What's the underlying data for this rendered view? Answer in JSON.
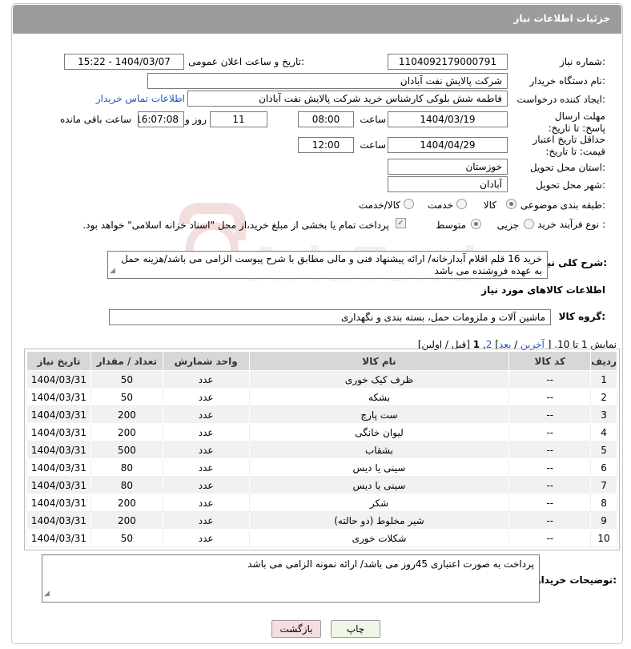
{
  "header": {
    "title": "جزئیات اطلاعات نیاز"
  },
  "form": {
    "need_number_label": "شماره نیاز:",
    "need_number": "1104092179000791",
    "announce_label": "تاریخ و ساعت اعلان عمومی:",
    "announce_value": "1404/03/07 - 15:22",
    "buyer_org_label": "نام دستگاه خریدار:",
    "buyer_org": "شرکت پالایش نفت آبادان",
    "requester_label": "ایجاد کننده درخواست:",
    "requester": "فاطمه شش بلوکی کارشناس خرید شرکت پالایش نفت آبادان",
    "contact_link": "اطلاعات تماس خریدار",
    "deadline_label": "مهلت ارسال پاسخ: تا تاریخ:",
    "deadline_date": "1404/03/19",
    "time_label": "ساعت",
    "deadline_time": "08:00",
    "days_value": "11",
    "days_label": "روز و",
    "remaining_time": "16:07:08",
    "remaining_label": "ساعت باقی مانده",
    "price_validity_label": "حداقل تاریخ اعتبار قیمت: تا تاریخ:",
    "price_validity_date": "1404/04/29",
    "price_validity_time": "12:00",
    "province_label": "استان محل تحویل:",
    "province": "خوزستان",
    "city_label": "شهر محل تحویل:",
    "city": "آبادان",
    "category_label": "طبقه بندی موضوعی:",
    "category_options": [
      "کالا",
      "خدمت",
      "کالا/خدمت"
    ],
    "category_selected": "کالا",
    "process_label": "نوع فرآیند خرید :",
    "process_options": [
      "جزیی",
      "متوسط"
    ],
    "process_selected": "متوسط",
    "payment_note": "پرداخت تمام یا بخشی از مبلغ خرید،از محل \"اسناد خزانه اسلامی\" خواهد بود."
  },
  "description": {
    "label": "شرح کلی نیاز:",
    "text": "خرید 16 قلم اقلام آبدارخانه/ ارائه پیشنهاد فنی و مالی مطابق با شرح پیوست الزامی می باشد/هزینه حمل به عهده فروشنده می باشد"
  },
  "goods": {
    "section_title": "اطلاعات کالاهای مورد نیاز",
    "group_label": "گروه کالا:",
    "group_value": "ماشین آلات و ملزومات حمل، بسته بندی و نگهداری",
    "pagination": {
      "showing": "نمایش 1 تا 10.",
      "open": "[",
      "last": "آخرین",
      "sep1": "/",
      "next": "بعد",
      "close1": "]",
      "page2": "2",
      "comma": ",",
      "page1": "1",
      "prev_first": "[قبل / اولین]"
    },
    "columns": [
      "ردیف",
      "کد کالا",
      "نام کالا",
      "واحد شمارش",
      "تعداد / مقدار",
      "تاریخ نیاز"
    ],
    "rows": [
      [
        "1",
        "--",
        "ظرف کیک خوری",
        "عدد",
        "50",
        "1404/03/31"
      ],
      [
        "2",
        "--",
        "بشکه",
        "عدد",
        "50",
        "1404/03/31"
      ],
      [
        "3",
        "--",
        "ست پارچ",
        "عدد",
        "200",
        "1404/03/31"
      ],
      [
        "4",
        "--",
        "لیوان خانگی",
        "عدد",
        "200",
        "1404/03/31"
      ],
      [
        "5",
        "--",
        "بشقاب",
        "عدد",
        "500",
        "1404/03/31"
      ],
      [
        "6",
        "--",
        "سینی یا دیس",
        "عدد",
        "80",
        "1404/03/31"
      ],
      [
        "7",
        "--",
        "سینی یا دیس",
        "عدد",
        "80",
        "1404/03/31"
      ],
      [
        "8",
        "--",
        "شکر",
        "عدد",
        "200",
        "1404/03/31"
      ],
      [
        "9",
        "--",
        "شیر مخلوط (دو حالته)",
        "عدد",
        "200",
        "1404/03/31"
      ],
      [
        "10",
        "--",
        "شکلات خوری",
        "عدد",
        "50",
        "1404/03/31"
      ]
    ]
  },
  "buyer_notes": {
    "label": "توضیحات خریدار:",
    "text": "پرداخت به صورت اعتباری 45روز می باشد/ ارائه نمونه الزامی می باشد"
  },
  "buttons": {
    "print": "چاپ",
    "back": "بازگشت"
  },
  "watermark": {
    "text": "AriaTender.neT"
  }
}
